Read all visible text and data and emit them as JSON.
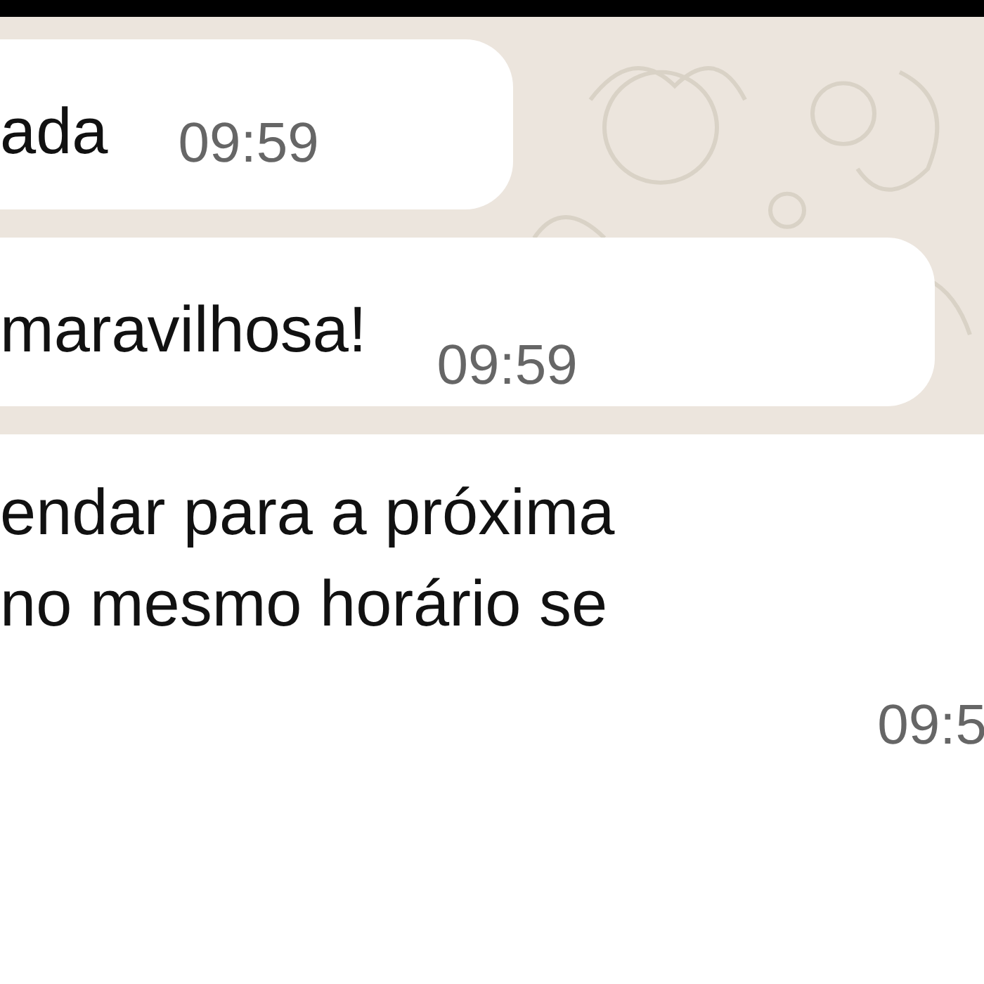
{
  "messages": [
    {
      "lines": [
        "ada"
      ],
      "time": "09:59"
    },
    {
      "lines": [
        "maravilhosa!"
      ],
      "time": "09:59"
    },
    {
      "lines": [
        "endar para a próxima",
        "no mesmo horário se"
      ],
      "time": "09:5"
    }
  ]
}
